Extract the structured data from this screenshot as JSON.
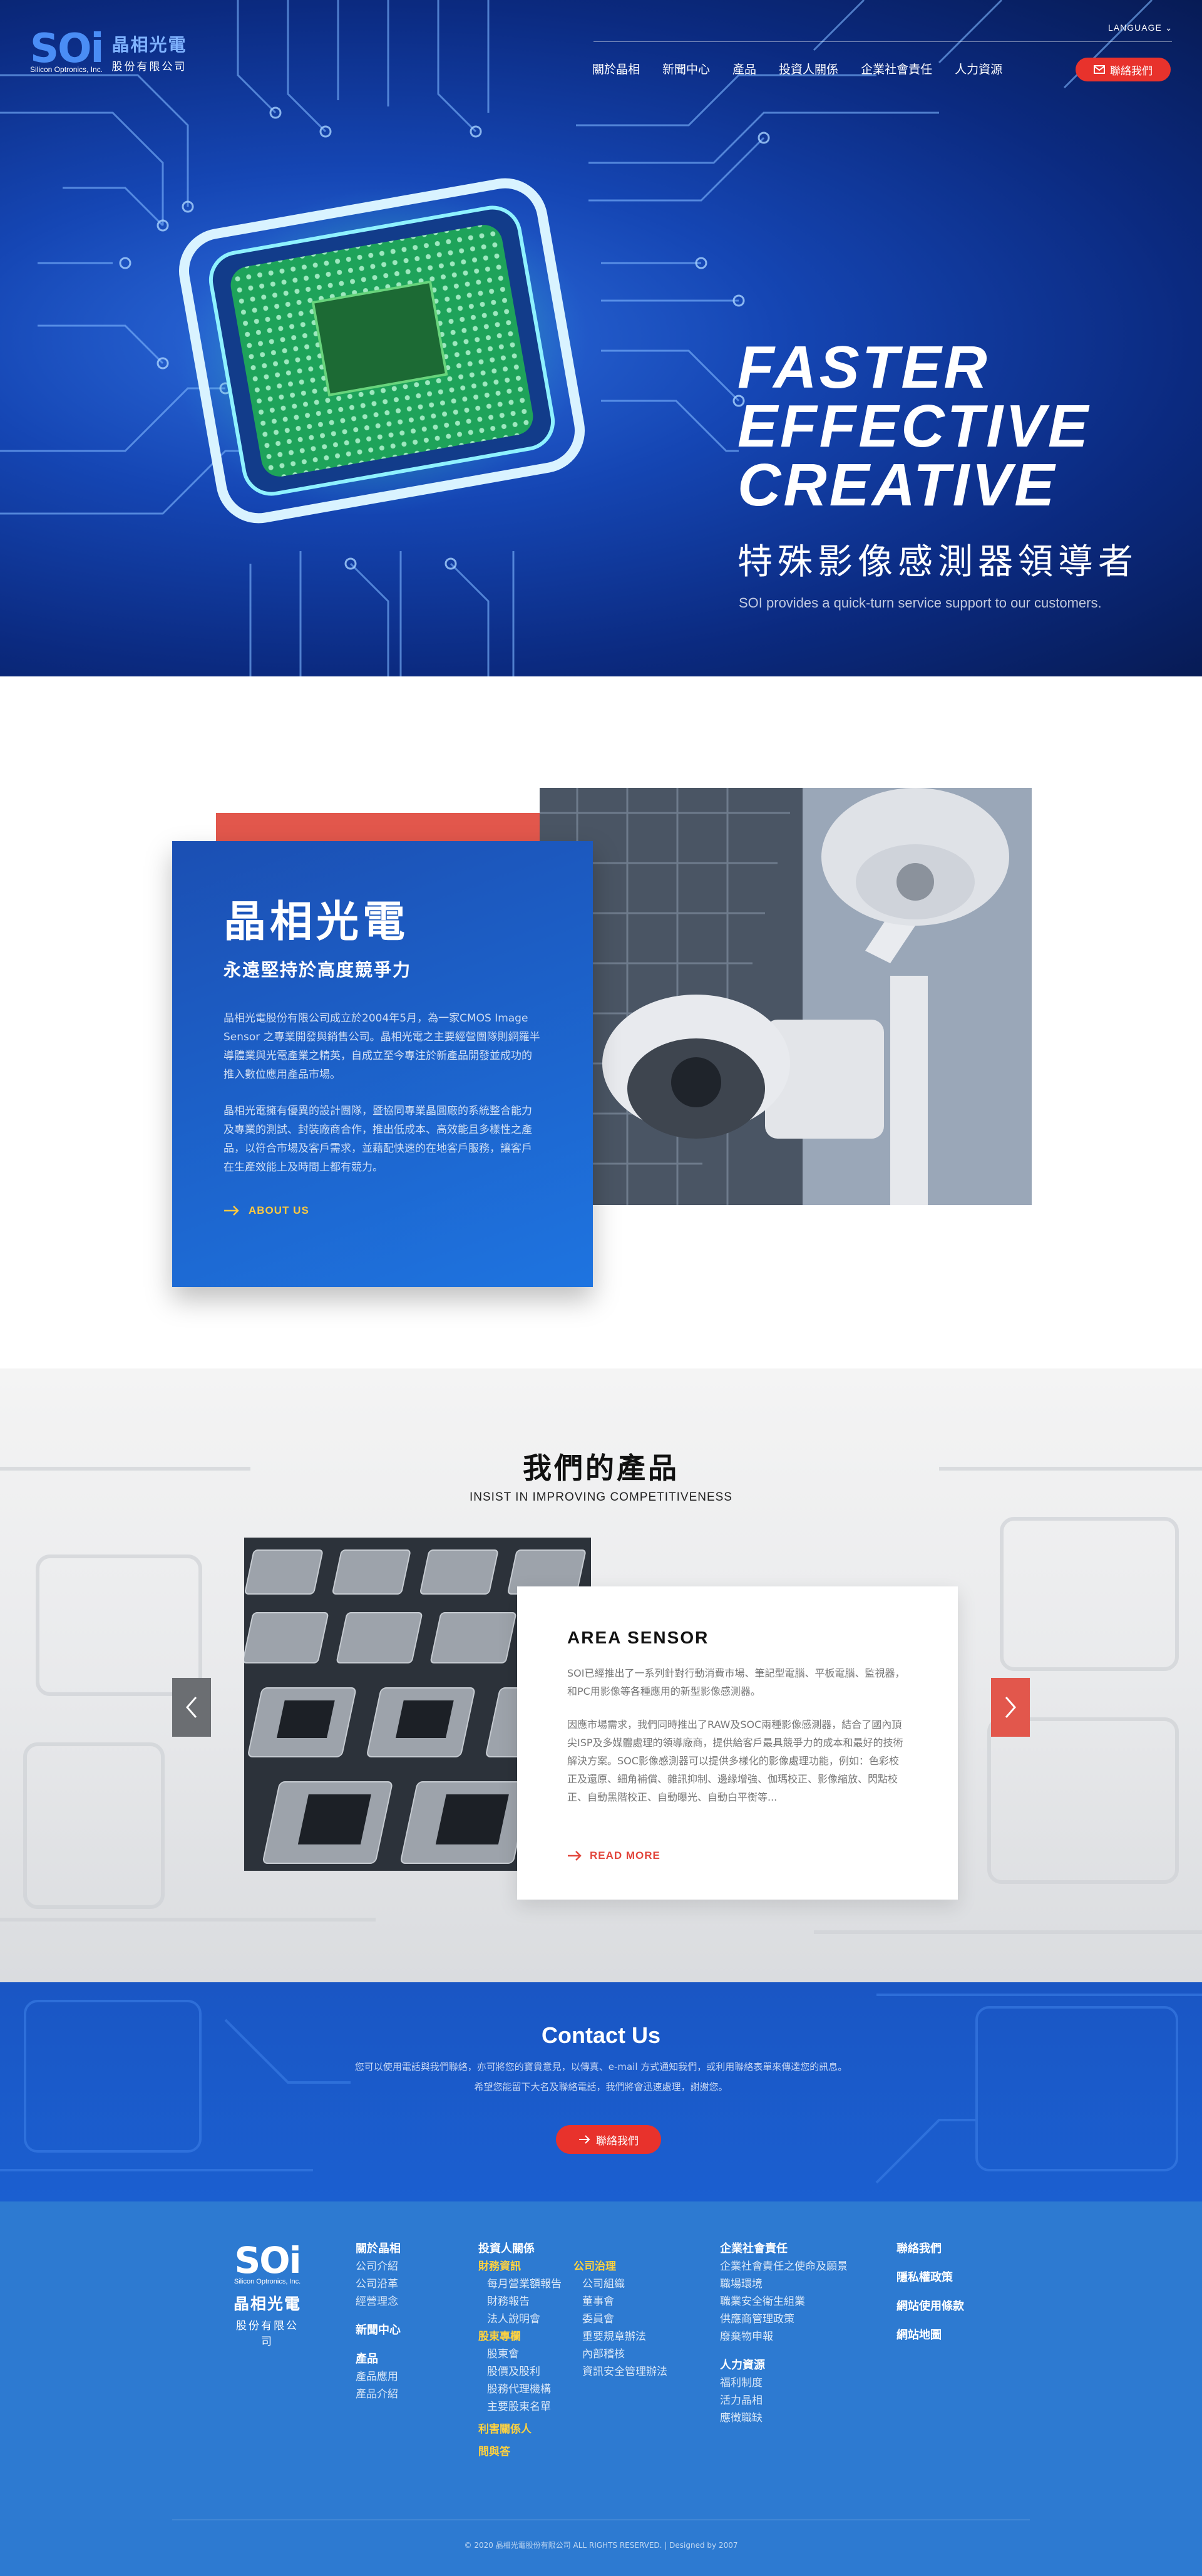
{
  "header": {
    "logo": {
      "mark": "SOi",
      "mark_sub": "Silicon Optronics, Inc.",
      "name_cn": "晶相光電",
      "name_cn_sub": "股份有限公司"
    },
    "language_label": "LANGUAGE",
    "nav": [
      "關於晶相",
      "新聞中心",
      "產品",
      "投資人關係",
      "企業社會責任",
      "人力資源"
    ],
    "contact_label": "聯絡我們"
  },
  "hero": {
    "title_lines": [
      "FASTER",
      "EFFECTIVE",
      "CREATIVE"
    ],
    "subtitle_cn": "特殊影像感測器領導者",
    "subtitle_en": "SOI provides a quick-turn service support to our customers."
  },
  "about": {
    "title": "晶相光電",
    "subtitle": "永遠堅持於高度競爭力",
    "para1": "晶相光電股份有限公司成立於2004年5月，為一家CMOS Image Sensor 之專業開發與銷售公司。晶相光電之主要經營團隊則網羅半導體業與光電產業之精英，自成立至今專注於新產品開發並成功的推入數位應用產品市場。",
    "para2": "晶相光電擁有優異的設計團隊，暨協同專業晶圓廠的系統整合能力及專業的測試、封裝廠商合作，推出低成本、高效能且多樣性之產品，以符合市場及客戶需求，並藉配快速的在地客戶服務，讓客戶在生產效能上及時間上都有競力。",
    "link": "ABOUT US"
  },
  "products": {
    "title": "我們的產品",
    "subtitle": "INSIST IN IMPROVING COMPETITIVENESS",
    "item": {
      "name": "AREA SENSOR",
      "para1": "SOI已經推出了一系列針對行動消費市場、筆記型電腦、平板電腦、監視器，和PC用影像等各種應用的新型影像感測器。",
      "para2": "因應市場需求，我們同時推出了RAW及SOC兩種影像感測器，結合了國內頂尖ISP及多媒體處理的領導廠商，提供給客戶最具競爭力的成本和最好的技術解決方案。SOC影像感測器可以提供多樣化的影像處理功能，例如：色彩校正及還原、細角補償、雜訊抑制、邊緣增強、伽瑪校正、影像縮放、閃點校正、自動黑階校正、自動曝光、自動白平衡等...",
      "link": "READ MORE"
    },
    "prev_icon": "chevron-left-icon",
    "next_icon": "chevron-right-icon"
  },
  "contact": {
    "title": "Contact Us",
    "line1": "您可以使用電話與我們聯絡，亦可將您的寶貴意見，以傳真、e-mail 方式通知我們，或利用聯絡表單來傳達您的訊息。",
    "line2": "希望您能留下大名及聯絡電話，我們將會迅速處理，謝謝您。",
    "button": "聯絡我們"
  },
  "footer": {
    "col1": {
      "h1": "關於晶相",
      "items1": [
        "公司介紹",
        "公司沿革",
        "經營理念"
      ],
      "h2": "新聞中心",
      "h3": "產品",
      "items3": [
        "產品應用",
        "產品介紹"
      ]
    },
    "col2": {
      "h": "投資人關係",
      "g1": "財務資訊",
      "g1_items": [
        "每月營業額報告",
        "財務報告",
        "法人說明會"
      ],
      "g2": "股東專欄",
      "g2_items": [
        "股東會",
        "股價及股利",
        "股務代理機構",
        "主要股東名單"
      ],
      "g3": "利害關係人",
      "g4": "問與答"
    },
    "col3": {
      "g": "公司治理",
      "items": [
        "公司組織",
        "董事會",
        "委員會",
        "重要規章辦法",
        "內部稽核",
        "資訊安全管理辦法"
      ]
    },
    "col4": {
      "h1": "企業社會責任",
      "items1": [
        "企業社會責任之使命及願景",
        "職場環境",
        "職業安全衛生組業",
        "供應商管理政策",
        "廢棄物申報"
      ],
      "h2": "人力資源",
      "items2": [
        "福利制度",
        "活力晶相",
        "應徵職缺"
      ]
    },
    "col5": [
      "聯絡我們",
      "隱私權政策",
      "網站使用條款",
      "網站地圖"
    ],
    "copyright": "© 2020 晶相光電股份有限公司 ALL RIGHTS RESERVED.   |   Designed by 2007"
  },
  "colors": {
    "primary_blue": "#1b5fd0",
    "accent_red": "#e8322c",
    "accent_yellow": "#ffd23f"
  }
}
